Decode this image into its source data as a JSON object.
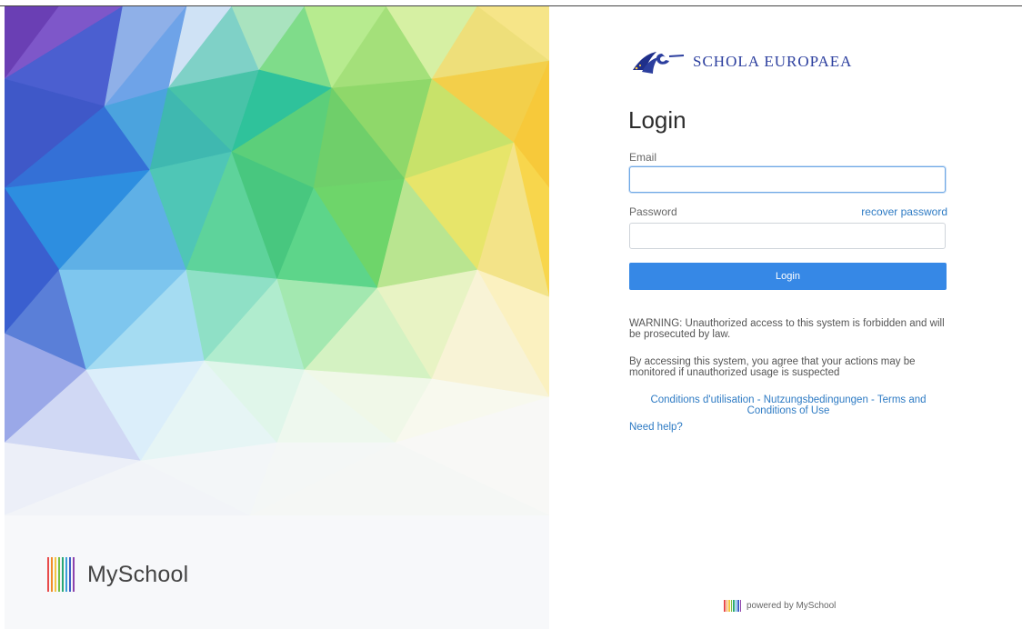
{
  "brand": {
    "name": "MySchool"
  },
  "logo": {
    "text": "SCHOLA EUROPAEA"
  },
  "login": {
    "title": "Login",
    "email_label": "Email",
    "email_value": "",
    "password_label": "Password",
    "password_value": "",
    "recover_link": "recover password",
    "submit_label": "Login"
  },
  "notices": {
    "warning": "WARNING: Unauthorized access to this system is forbidden and will be prosecuted by law.",
    "monitoring": "By accessing this system, you agree that your actions may be monitored if unauthorized usage is suspected"
  },
  "links": {
    "conditions": "Conditions d'utilisation - Nutzungsbedingungen - Terms and Conditions of Use",
    "help": "Need help?"
  },
  "footer": {
    "powered": "powered by MySchool"
  },
  "colors": {
    "accent": "#3688e6",
    "link": "#2e7bc4",
    "brand_bars": [
      "#e84b4b",
      "#f28c28",
      "#f5c542",
      "#7bc043",
      "#2aa876",
      "#3aa0d8",
      "#3d5fc7",
      "#8e44ad"
    ]
  }
}
